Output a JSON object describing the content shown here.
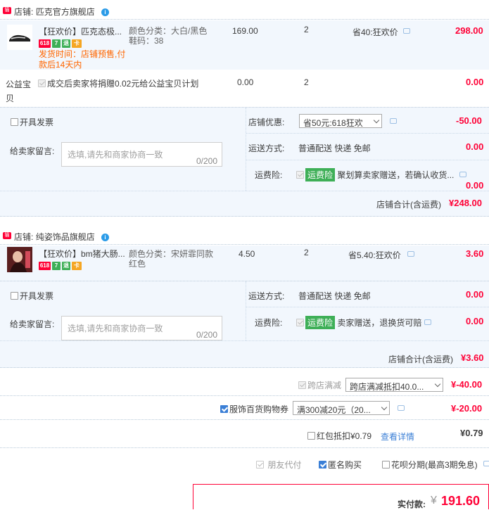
{
  "shop1": {
    "label": "店铺:",
    "name": "匹克官方旗舰店",
    "item": {
      "title": "【狂欢价】匹克态极...",
      "color_label": "颜色分类：",
      "color": "大白/黑色",
      "size": "鞋码：38",
      "price": "169.00",
      "qty": "2",
      "discount": "省40:狂欢价",
      "total": "298.00",
      "ship_note": "发货时间：店铺预售,付款后14天内",
      "tags": [
        "618",
        "7",
        "退",
        "卡"
      ]
    },
    "charity": {
      "label": "公益宝贝",
      "desc": "成交后卖家将捐赠0.02元给公益宝贝计划",
      "price": "0.00",
      "qty": "2",
      "total": "0.00"
    },
    "invoice_label": "开具发票",
    "memo_label": "给卖家留言:",
    "memo_placeholder": "选填,请先和商家协商一致",
    "memo_count": "0/200",
    "promo_label": "店铺优惠:",
    "promo_value": "省50元:618狂欢",
    "promo_amount": "-50.00",
    "ship_label": "运送方式:",
    "ship_value": "普通配送 快递 免邮",
    "ship_amount": "0.00",
    "insure_label": "运费险:",
    "insure_badge": "运费险",
    "insure_desc": "聚划算卖家赠送，若确认收货...",
    "insure_amount": "0.00",
    "subtotal_label": "店铺合计(含运费)",
    "subtotal": "¥248.00"
  },
  "shop2": {
    "label": "店铺:",
    "name": "纯姿饰品旗舰店",
    "item": {
      "title": "【狂欢价】bm猪大肠...",
      "color_label": "颜色分类：",
      "color": "宋妍霏同款",
      "color2": "红色",
      "price": "4.50",
      "qty": "2",
      "discount": "省5.40:狂欢价",
      "total": "3.60",
      "tags": [
        "618",
        "7",
        "退",
        "卡"
      ]
    },
    "invoice_label": "开具发票",
    "memo_label": "给卖家留言:",
    "memo_placeholder": "选填,请先和商家协商一致",
    "memo_count": "0/200",
    "ship_label": "运送方式:",
    "ship_value": "普通配送 快递 免邮",
    "ship_amount": "0.00",
    "insure_label": "运费险:",
    "insure_badge": "运费险",
    "insure_desc": "卖家赠送，退换货可赔",
    "insure_amount": "0.00",
    "subtotal_label": "店铺合计(含运费)",
    "subtotal": "¥3.60"
  },
  "summary": {
    "cross_label": "跨店满减",
    "cross_value": "跨店满减抵扣40.0...",
    "cross_amount": "¥-40.00",
    "coupon_label": "服饰百货购物券",
    "coupon_value": "满300减20元（20...",
    "coupon_amount": "¥-20.00",
    "redpack_label": "红包抵扣¥0.79",
    "redpack_link": "查看详情",
    "redpack_amount": "¥0.79",
    "friend_pay": "朋友代付",
    "anon": "匿名购买",
    "huabei": "花呗分期(最高3期免息)",
    "pay_label": "实付款:",
    "pay_currency": "¥",
    "pay_amount": "191.60"
  },
  "colors": {
    "accent": "#ff0036",
    "panel": "#f2f7fd",
    "badge_green": "#3eaf57",
    "orange": "#ff6600"
  }
}
